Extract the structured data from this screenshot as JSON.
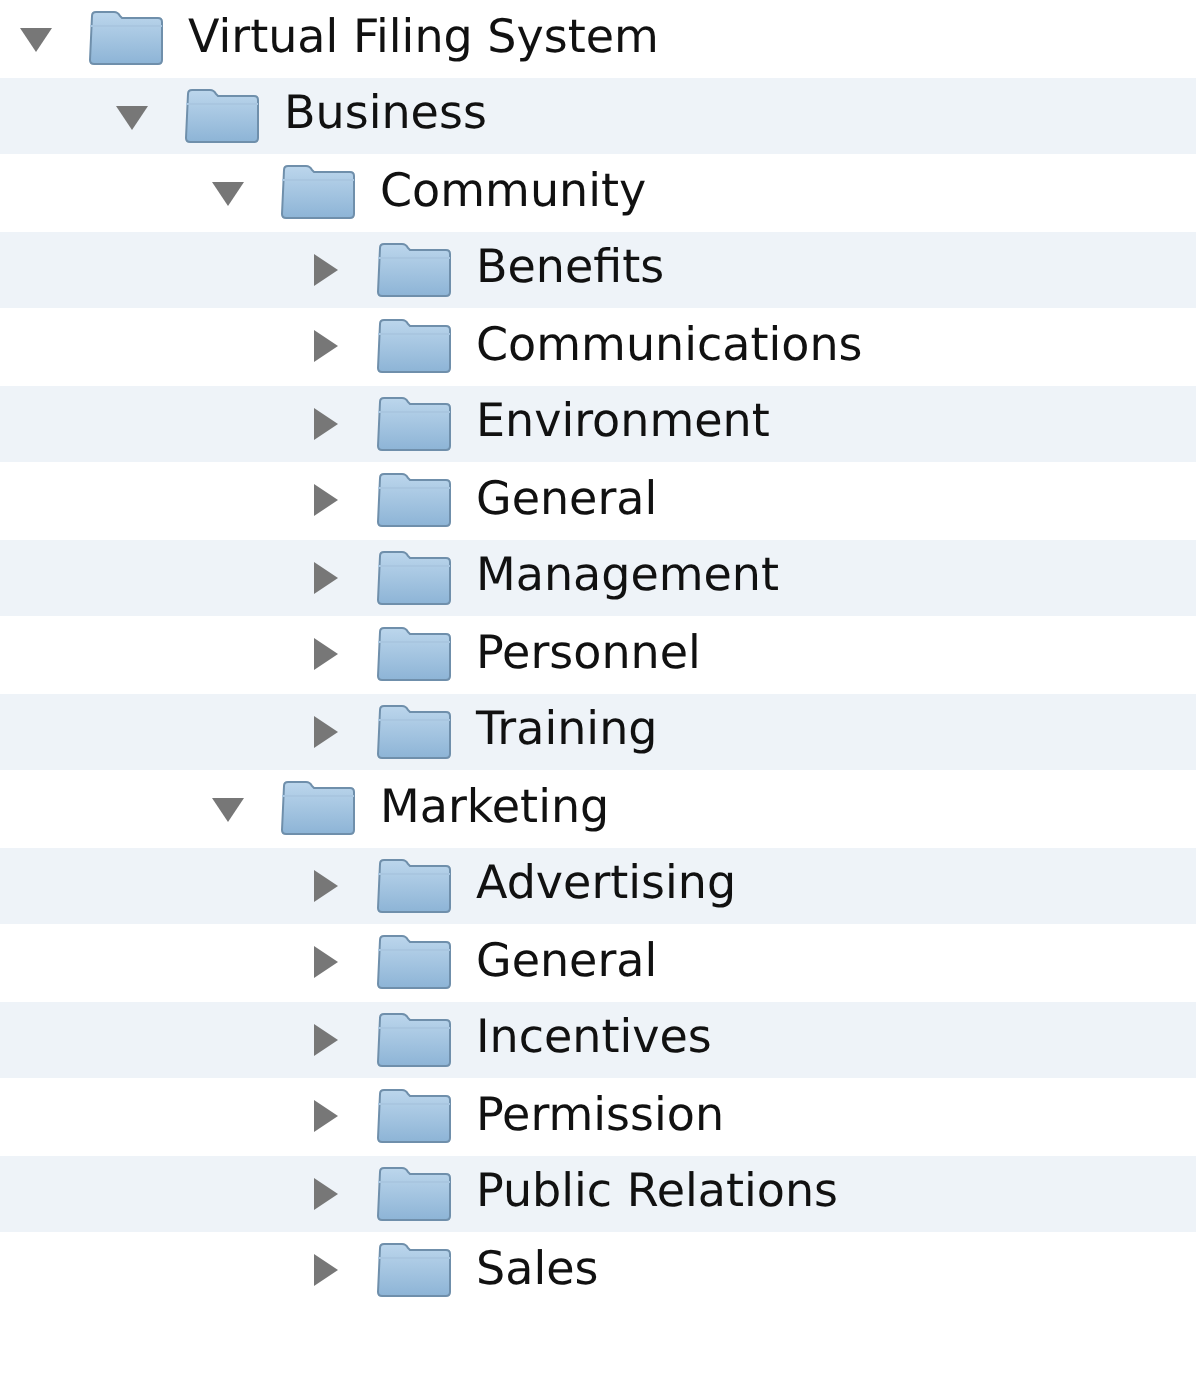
{
  "tree": [
    {
      "label": "Virtual Filing System",
      "expanded": true,
      "children": [
        {
          "label": "Business",
          "expanded": true,
          "children": [
            {
              "label": "Community",
              "expanded": true,
              "children": [
                {
                  "label": "Benefits",
                  "expanded": false
                },
                {
                  "label": "Communications",
                  "expanded": false
                },
                {
                  "label": "Environment",
                  "expanded": false
                },
                {
                  "label": "General",
                  "expanded": false
                },
                {
                  "label": "Management",
                  "expanded": false
                },
                {
                  "label": "Personnel",
                  "expanded": false
                },
                {
                  "label": "Training",
                  "expanded": false
                }
              ]
            },
            {
              "label": "Marketing",
              "expanded": true,
              "children": [
                {
                  "label": "Advertising",
                  "expanded": false
                },
                {
                  "label": "General",
                  "expanded": false
                },
                {
                  "label": "Incentives",
                  "expanded": false
                },
                {
                  "label": "Permission",
                  "expanded": false
                },
                {
                  "label": "Public Relations",
                  "expanded": false
                },
                {
                  "label": "Sales",
                  "expanded": false
                }
              ]
            }
          ]
        }
      ]
    }
  ]
}
